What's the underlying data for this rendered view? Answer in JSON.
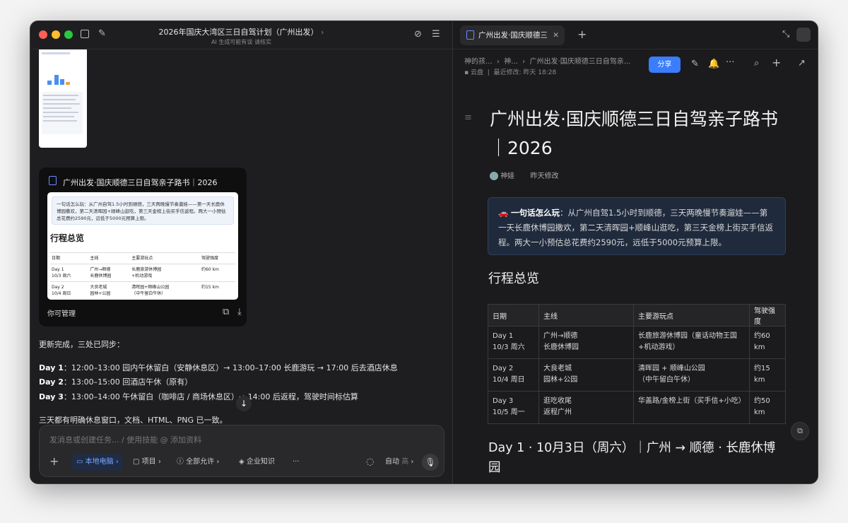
{
  "left": {
    "title": "2026年国庆大湾区三日自驾计划（广州出发）",
    "subtitle": "AI 生成可能有误 请核实",
    "card": {
      "title": "广州出发·国庆顺德三日自驾亲子路书｜2026",
      "footer": "你可管理",
      "preview": {
        "banner": "一句话怎么玩：从广州自驾1.5小时到顺德，三天两晚慢节奏遛娃——第一天长鹿休博园撒欢，第二天清晖园+顺峰山逛吃，第三天金榜上街买手信返程。两大一小预估总花费约2590元，远低于5000元预算上限。",
        "heading": "行程总览",
        "headers": [
          "日期",
          "主线",
          "主要游玩点",
          "驾驶强度"
        ],
        "rows": [
          [
            "Day 1\n10/3 周六",
            "广州→顺德\n长鹿休博园",
            "长鹿旅游休博园\n+机动游戏",
            "约60 km"
          ],
          [
            "Day 2\n10/4 周日",
            "大良老城\n园林+公园",
            "清晖园+顺峰山公园\n（中午留白午休）",
            "约15 km"
          ]
        ]
      }
    },
    "messages": {
      "intro": "更新完成，三处已同步：",
      "d1_label": "Day 1",
      "d1_text": "：12:00–13:00 园内午休留白（安静休息区）→ 13:00–17:00 长鹿游玩 → 17:00 后去酒店休息",
      "d2_label": "Day 2",
      "d2_text": "：13:00–15:00 回酒店午休（原有）",
      "d3_label": "Day 3",
      "d3_text": "：13:00–14:00 午休留白（咖啡店 / 商场休息区）→ 14:00 后返程，驾驶时间标估算",
      "outro": "三天都有明确休息窗口，文档、HTML、PNG 已一致。"
    },
    "composer": {
      "placeholder": "发消息或创建任务... / 使用技能 @ 添加资料",
      "chips": [
        "本地电脑",
        "项目",
        "全部允许",
        "企业知识"
      ],
      "mode": "自动",
      "mode_level": "高"
    }
  },
  "right": {
    "tab_title": "广州出发·国庆顺德三",
    "breadcrumb": [
      "神的孩...",
      "神...",
      "广州出发·国庆顺德三日自驾亲..."
    ],
    "location": "云盘",
    "modified": "最近修改: 昨天 18:28",
    "share_label": "分享",
    "doc_title": "广州出发·国庆顺德三日自驾亲子路书｜2026",
    "author": "神娃",
    "author_time": "昨天修改",
    "callout_label": "一句话怎么玩",
    "callout_text": "：从广州自驾1.5小时到顺德，三天两晚慢节奏遛娃——第一天长鹿休博园撒欢，第二天清晖园+顺峰山逛吃，第三天金榜上街买手信返程。两大一小预估总花费约2590元，远低于5000元预算上限。",
    "section_title": "行程总览",
    "table": {
      "headers": [
        "日期",
        "主线",
        "主要游玩点",
        "驾驶强度"
      ],
      "rows": [
        [
          "Day 1\n10/3 周六",
          "广州→顺德\n长鹿休博园",
          "长鹿旅游休博园（童话动物王国+机动游戏）",
          "约60 km"
        ],
        [
          "Day 2\n10/4 周日",
          "大良老城\n园林+公园",
          "清晖园 + 顺峰山公园\n（中午留白午休）",
          "约15 km"
        ],
        [
          "Day 3\n10/5 周一",
          "逛吃收尾\n返程广州",
          "华盖路/金榜上街（买手信+小吃）",
          "约50 km"
        ]
      ]
    },
    "next_heading": "Day 1 · 10月3日（周六）｜广州 → 顺德 · 长鹿休博园"
  },
  "colors": {
    "accent": "#3a7dff",
    "callout_bg": "#1f2a3d"
  }
}
